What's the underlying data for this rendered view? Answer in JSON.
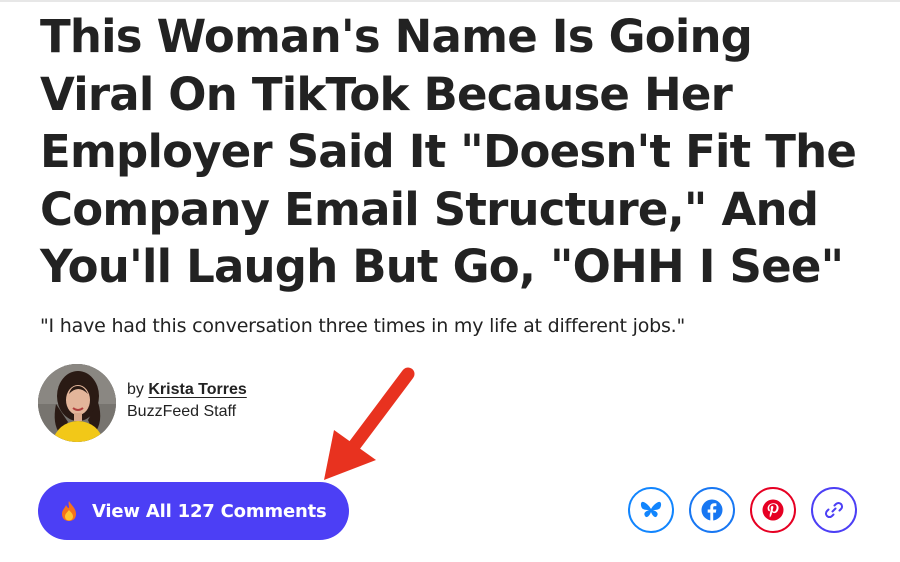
{
  "article": {
    "headline": "This Woman's Name Is Going Viral On TikTok Because Her Employer Said It \"Doesn't Fit The Company Email Structure,\" And You'll Laugh But Go, \"OHH I See\"",
    "dek": "\"I have had this conversation three times in my life at different jobs.\""
  },
  "byline": {
    "prefix": "by",
    "author": "Krista Torres",
    "role": "BuzzFeed Staff"
  },
  "comments_button": {
    "icon": "fire-icon",
    "label": "View All 127 Comments",
    "color": "#4c3ff5"
  },
  "annotation": {
    "icon": "red-arrow-icon",
    "color": "#e8321f"
  },
  "share": [
    {
      "network": "Bluesky",
      "icon": "butterfly-icon",
      "color": "#1185fe"
    },
    {
      "network": "Facebook",
      "icon": "facebook-icon",
      "color": "#1877f2"
    },
    {
      "network": "Pinterest",
      "icon": "pinterest-icon",
      "color": "#e60023"
    },
    {
      "network": "Copy link",
      "icon": "link-icon",
      "color": "#4c3ff5"
    }
  ]
}
